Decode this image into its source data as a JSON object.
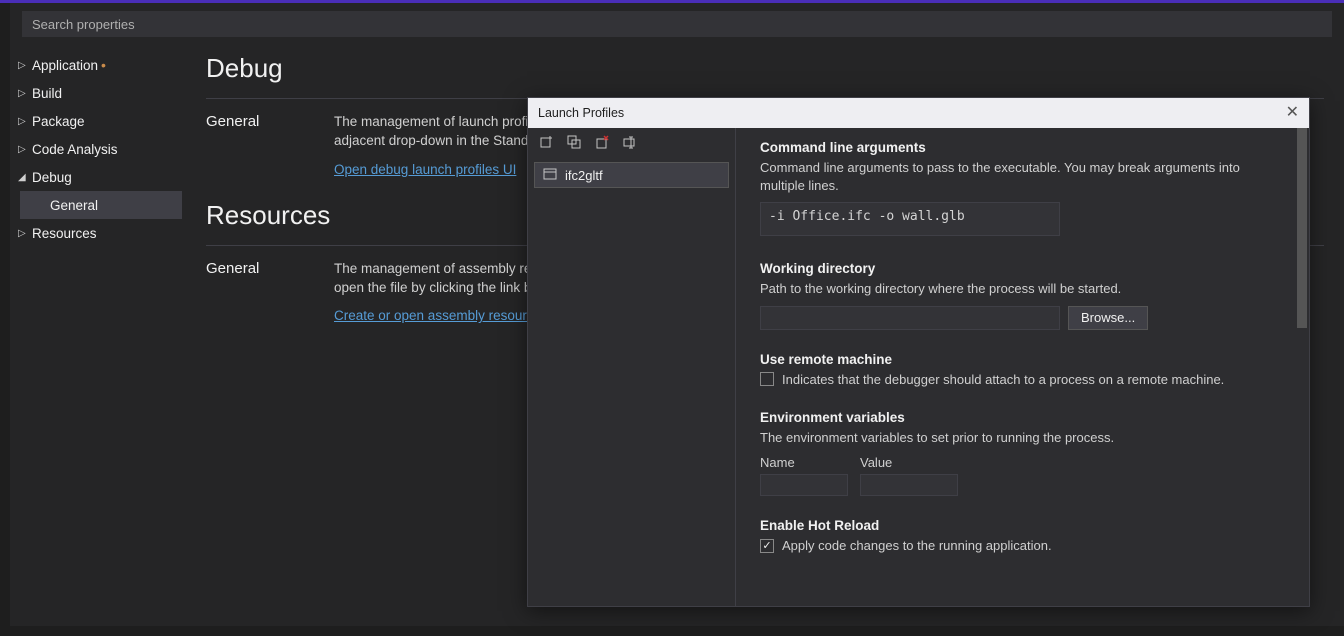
{
  "search": {
    "placeholder": "Search properties"
  },
  "sidebar": {
    "items": [
      {
        "label": "Application",
        "expanded": false,
        "dirty": true
      },
      {
        "label": "Build",
        "expanded": false
      },
      {
        "label": "Package",
        "expanded": false
      },
      {
        "label": "Code Analysis",
        "expanded": false
      },
      {
        "label": "Debug",
        "expanded": true,
        "children": [
          {
            "label": "General",
            "selected": true
          }
        ]
      },
      {
        "label": "Resources",
        "expanded": false
      }
    ]
  },
  "main": {
    "section1": {
      "title": "Debug",
      "row_label": "General",
      "body": "The management of launch profiles has moved to a dedicated dialog. It may be accessed via the link below, via the Debug menu in the main menu bar, or via the adjacent drop-down in the Standard tool bar.",
      "link": "Open debug launch profiles UI"
    },
    "section2": {
      "title": "Resources",
      "row_label": "General",
      "body": "The management of assembly resources has moved to a dedicated editor. You may create and/or open the RESX file directly from Solution Explorer, or you may open the file by clicking the link below.",
      "link": "Create or open assembly resources"
    }
  },
  "dialog": {
    "title": "Launch Profiles",
    "profile_name": "ifc2gltf",
    "cmd": {
      "title": "Command line arguments",
      "desc": "Command line arguments to pass to the executable. You may break arguments into multiple lines.",
      "value": "-i Office.ifc -o wall.glb"
    },
    "wd": {
      "title": "Working directory",
      "desc": "Path to the working directory where the process will be started.",
      "value": "",
      "browse": "Browse..."
    },
    "remote": {
      "title": "Use remote machine",
      "desc": "Indicates that the debugger should attach to a process on a remote machine."
    },
    "env": {
      "title": "Environment variables",
      "desc": "The environment variables to set prior to running the process.",
      "col1": "Name",
      "col2": "Value"
    },
    "hot": {
      "title": "Enable Hot Reload",
      "desc": "Apply code changes to the running application."
    }
  }
}
